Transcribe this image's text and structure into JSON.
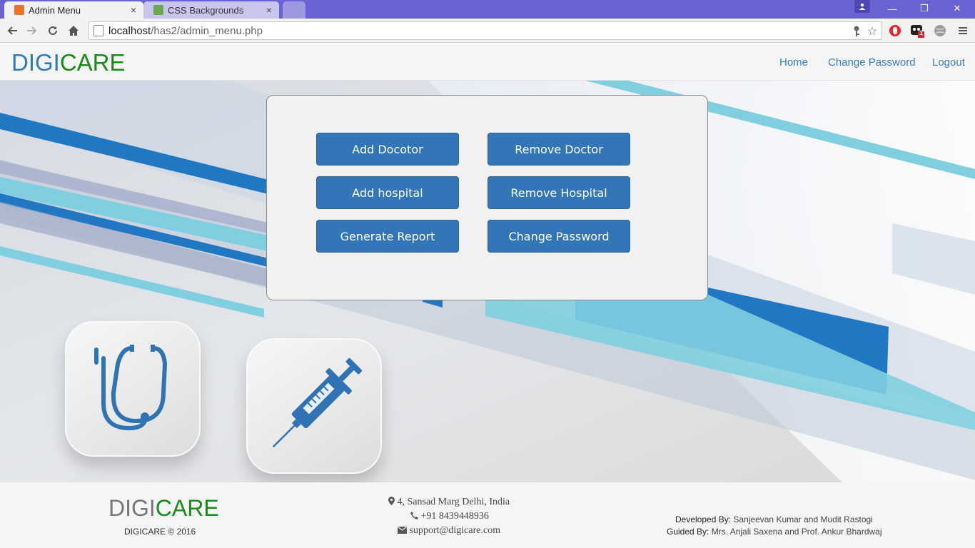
{
  "browser": {
    "tabs": [
      {
        "title": "Admin Menu",
        "close": "×",
        "favicon_color": "#e8742a"
      },
      {
        "title": "CSS Backgrounds",
        "close": "×",
        "favicon_color": "#6aa84f"
      }
    ],
    "window_controls": {
      "minimize": "—",
      "restore": "❐",
      "close": "✕"
    },
    "address": {
      "host": "localhost",
      "path": "/has2/admin_menu.php"
    },
    "extension_badge": "1"
  },
  "site": {
    "brand_part1": "DIGI",
    "brand_part2": "CARE",
    "nav": {
      "home": "Home",
      "change_password": "Change Password",
      "logout": "Logout"
    }
  },
  "admin_menu": {
    "add_doctor": "Add Docotor",
    "remove_doctor": "Remove Doctor",
    "add_hospital": "Add hospital",
    "remove_hospital": "Remove Hospital",
    "generate_report": "Generate Report",
    "change_password": "Change Password"
  },
  "hero_icons": {
    "left": "stethoscope-icon",
    "right": "syringe-icon"
  },
  "footer": {
    "brand_part1": "DIGI",
    "brand_part2": "CARE",
    "copyright": "DIGICARE © 2016",
    "address": "4,  Sansad Marg Delhi, India",
    "phone": "+91 8439448936",
    "email": "support@digicare.com",
    "developed_label": "Developed By:",
    "developed_names": "Sanjeevan Kumar and Mudit Rastogi",
    "guided_label": "Guided By:",
    "guided_names": "Mrs. Anjali Saxena and Prof. Ankur Bhardwaj"
  },
  "colors": {
    "accent": "#3376b7",
    "brand_blue": "#2f7bbf",
    "brand_green": "#1a8a1a",
    "titlebar": "#6a63d4"
  }
}
